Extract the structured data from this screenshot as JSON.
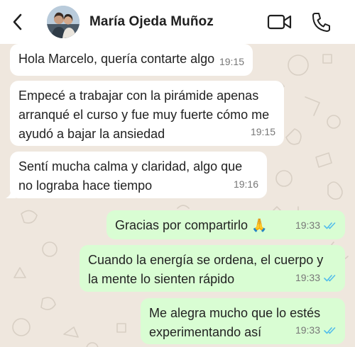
{
  "header": {
    "contact_name": "María Ojeda Muñoz",
    "back_icon": "chevron-left-icon",
    "video_icon": "video-camera-icon",
    "call_icon": "phone-icon"
  },
  "colors": {
    "header_bg": "#ffffff",
    "chat_bg": "#efe7de",
    "incoming_bubble": "#ffffff",
    "outgoing_bubble": "#d9fdd3",
    "read_ticks": "#53bdeb"
  },
  "messages": [
    {
      "direction": "incoming",
      "text": "Hola Marcelo, quería contarte algo",
      "time": "19:15"
    },
    {
      "direction": "incoming",
      "text": "Empecé a trabajar con la pirámide apenas arranqué el curso y fue muy fuerte cómo me ayudó a bajar la ansiedad",
      "time": "19:15"
    },
    {
      "direction": "incoming",
      "text": "Sentí mucha calma y claridad, algo que no lograba hace tiempo",
      "time": "19:16"
    },
    {
      "direction": "outgoing",
      "text": "Gracias por compartirlo 🙏",
      "time": "19:33",
      "status": "read"
    },
    {
      "direction": "outgoing",
      "text": "Cuando la energía se ordena, el cuerpo y la mente lo sienten rápido",
      "time": "19:33",
      "status": "read"
    },
    {
      "direction": "outgoing",
      "text": "Me alegra mucho que lo estés experimentando así",
      "time": "19:33",
      "status": "read"
    }
  ]
}
